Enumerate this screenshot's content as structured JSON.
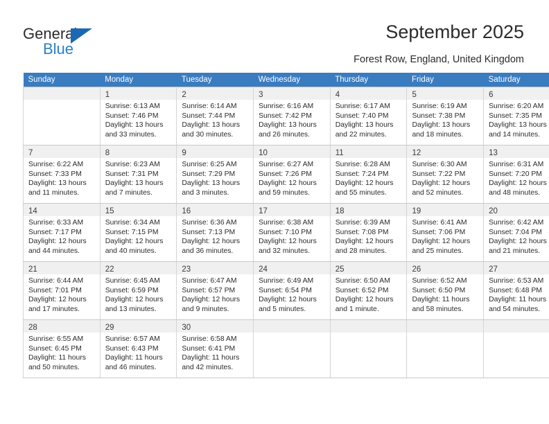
{
  "brand": {
    "name_top": "General",
    "name_bottom": "Blue",
    "accent_color": "#1b69b4",
    "accent_color_light": "#2a7fc9"
  },
  "header": {
    "title": "September 2025",
    "subtitle": "Forest Row, England, United Kingdom"
  },
  "calendar": {
    "header_bg": "#3a7cc0",
    "daynum_bg": "#f0f0f0",
    "weekdays": [
      "Sunday",
      "Monday",
      "Tuesday",
      "Wednesday",
      "Thursday",
      "Friday",
      "Saturday"
    ],
    "weeks": [
      [
        {
          "day": "",
          "lines": []
        },
        {
          "day": "1",
          "lines": [
            "Sunrise: 6:13 AM",
            "Sunset: 7:46 PM",
            "Daylight: 13 hours",
            "and 33 minutes."
          ]
        },
        {
          "day": "2",
          "lines": [
            "Sunrise: 6:14 AM",
            "Sunset: 7:44 PM",
            "Daylight: 13 hours",
            "and 30 minutes."
          ]
        },
        {
          "day": "3",
          "lines": [
            "Sunrise: 6:16 AM",
            "Sunset: 7:42 PM",
            "Daylight: 13 hours",
            "and 26 minutes."
          ]
        },
        {
          "day": "4",
          "lines": [
            "Sunrise: 6:17 AM",
            "Sunset: 7:40 PM",
            "Daylight: 13 hours",
            "and 22 minutes."
          ]
        },
        {
          "day": "5",
          "lines": [
            "Sunrise: 6:19 AM",
            "Sunset: 7:38 PM",
            "Daylight: 13 hours",
            "and 18 minutes."
          ]
        },
        {
          "day": "6",
          "lines": [
            "Sunrise: 6:20 AM",
            "Sunset: 7:35 PM",
            "Daylight: 13 hours",
            "and 14 minutes."
          ]
        }
      ],
      [
        {
          "day": "7",
          "lines": [
            "Sunrise: 6:22 AM",
            "Sunset: 7:33 PM",
            "Daylight: 13 hours",
            "and 11 minutes."
          ]
        },
        {
          "day": "8",
          "lines": [
            "Sunrise: 6:23 AM",
            "Sunset: 7:31 PM",
            "Daylight: 13 hours",
            "and 7 minutes."
          ]
        },
        {
          "day": "9",
          "lines": [
            "Sunrise: 6:25 AM",
            "Sunset: 7:29 PM",
            "Daylight: 13 hours",
            "and 3 minutes."
          ]
        },
        {
          "day": "10",
          "lines": [
            "Sunrise: 6:27 AM",
            "Sunset: 7:26 PM",
            "Daylight: 12 hours",
            "and 59 minutes."
          ]
        },
        {
          "day": "11",
          "lines": [
            "Sunrise: 6:28 AM",
            "Sunset: 7:24 PM",
            "Daylight: 12 hours",
            "and 55 minutes."
          ]
        },
        {
          "day": "12",
          "lines": [
            "Sunrise: 6:30 AM",
            "Sunset: 7:22 PM",
            "Daylight: 12 hours",
            "and 52 minutes."
          ]
        },
        {
          "day": "13",
          "lines": [
            "Sunrise: 6:31 AM",
            "Sunset: 7:20 PM",
            "Daylight: 12 hours",
            "and 48 minutes."
          ]
        }
      ],
      [
        {
          "day": "14",
          "lines": [
            "Sunrise: 6:33 AM",
            "Sunset: 7:17 PM",
            "Daylight: 12 hours",
            "and 44 minutes."
          ]
        },
        {
          "day": "15",
          "lines": [
            "Sunrise: 6:34 AM",
            "Sunset: 7:15 PM",
            "Daylight: 12 hours",
            "and 40 minutes."
          ]
        },
        {
          "day": "16",
          "lines": [
            "Sunrise: 6:36 AM",
            "Sunset: 7:13 PM",
            "Daylight: 12 hours",
            "and 36 minutes."
          ]
        },
        {
          "day": "17",
          "lines": [
            "Sunrise: 6:38 AM",
            "Sunset: 7:10 PM",
            "Daylight: 12 hours",
            "and 32 minutes."
          ]
        },
        {
          "day": "18",
          "lines": [
            "Sunrise: 6:39 AM",
            "Sunset: 7:08 PM",
            "Daylight: 12 hours",
            "and 28 minutes."
          ]
        },
        {
          "day": "19",
          "lines": [
            "Sunrise: 6:41 AM",
            "Sunset: 7:06 PM",
            "Daylight: 12 hours",
            "and 25 minutes."
          ]
        },
        {
          "day": "20",
          "lines": [
            "Sunrise: 6:42 AM",
            "Sunset: 7:04 PM",
            "Daylight: 12 hours",
            "and 21 minutes."
          ]
        }
      ],
      [
        {
          "day": "21",
          "lines": [
            "Sunrise: 6:44 AM",
            "Sunset: 7:01 PM",
            "Daylight: 12 hours",
            "and 17 minutes."
          ]
        },
        {
          "day": "22",
          "lines": [
            "Sunrise: 6:45 AM",
            "Sunset: 6:59 PM",
            "Daylight: 12 hours",
            "and 13 minutes."
          ]
        },
        {
          "day": "23",
          "lines": [
            "Sunrise: 6:47 AM",
            "Sunset: 6:57 PM",
            "Daylight: 12 hours",
            "and 9 minutes."
          ]
        },
        {
          "day": "24",
          "lines": [
            "Sunrise: 6:49 AM",
            "Sunset: 6:54 PM",
            "Daylight: 12 hours",
            "and 5 minutes."
          ]
        },
        {
          "day": "25",
          "lines": [
            "Sunrise: 6:50 AM",
            "Sunset: 6:52 PM",
            "Daylight: 12 hours",
            "and 1 minute."
          ]
        },
        {
          "day": "26",
          "lines": [
            "Sunrise: 6:52 AM",
            "Sunset: 6:50 PM",
            "Daylight: 11 hours",
            "and 58 minutes."
          ]
        },
        {
          "day": "27",
          "lines": [
            "Sunrise: 6:53 AM",
            "Sunset: 6:48 PM",
            "Daylight: 11 hours",
            "and 54 minutes."
          ]
        }
      ],
      [
        {
          "day": "28",
          "lines": [
            "Sunrise: 6:55 AM",
            "Sunset: 6:45 PM",
            "Daylight: 11 hours",
            "and 50 minutes."
          ]
        },
        {
          "day": "29",
          "lines": [
            "Sunrise: 6:57 AM",
            "Sunset: 6:43 PM",
            "Daylight: 11 hours",
            "and 46 minutes."
          ]
        },
        {
          "day": "30",
          "lines": [
            "Sunrise: 6:58 AM",
            "Sunset: 6:41 PM",
            "Daylight: 11 hours",
            "and 42 minutes."
          ]
        },
        {
          "day": "",
          "lines": []
        },
        {
          "day": "",
          "lines": []
        },
        {
          "day": "",
          "lines": []
        },
        {
          "day": "",
          "lines": []
        }
      ]
    ]
  }
}
